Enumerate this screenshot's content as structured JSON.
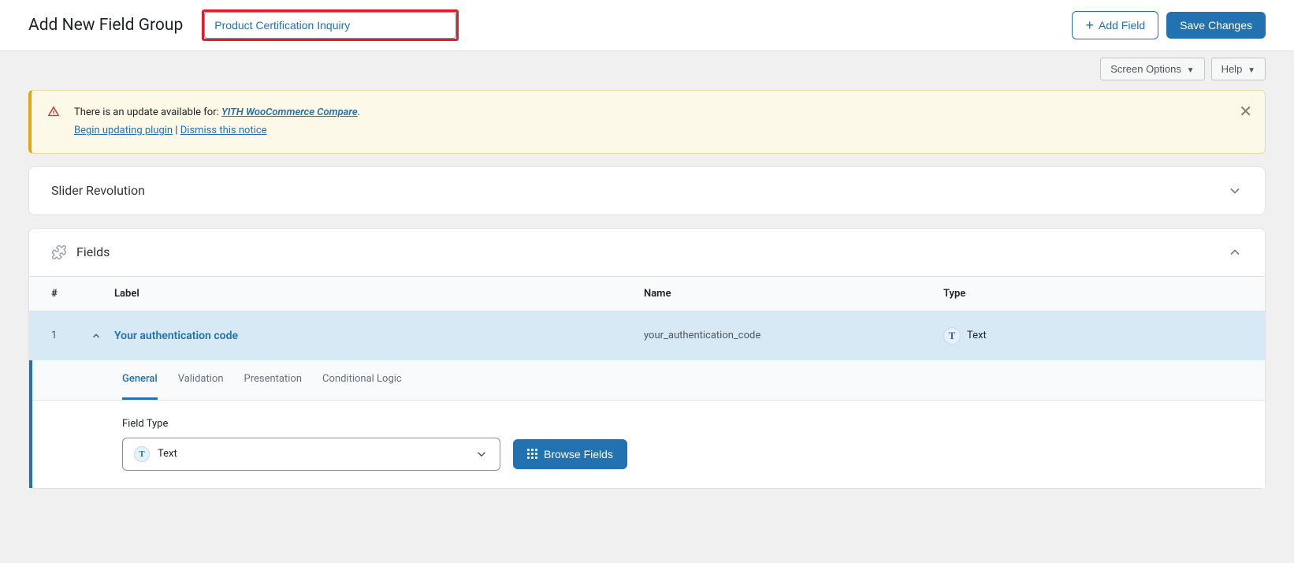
{
  "header": {
    "title": "Add New Field Group",
    "titleInputValue": "Product Certification Inquiry",
    "addFieldLabel": "Add Field",
    "saveLabel": "Save Changes"
  },
  "topControls": {
    "screenOptions": "Screen Options",
    "help": "Help"
  },
  "notice": {
    "line1_prefix": "There is an update available for: ",
    "line1_link": "YITH WooCommerce Compare",
    "line1_suffix": ".",
    "line2_link1": "Begin updating plugin",
    "line2_sep": " | ",
    "line2_link2": "Dismiss this notice"
  },
  "sliderPanel": {
    "title": "Slider Revolution"
  },
  "fieldsPanel": {
    "title": "Fields",
    "columns": {
      "num": "#",
      "label": "Label",
      "name": "Name",
      "type": "Type"
    },
    "row": {
      "num": "1",
      "label": "Your authentication code",
      "name": "your_authentication_code",
      "typeLabel": "Text",
      "typeIconLetter": "T"
    },
    "tabs": {
      "general": "General",
      "validation": "Validation",
      "presentation": "Presentation",
      "conditional": "Conditional Logic"
    },
    "form": {
      "fieldTypeLabel": "Field Type",
      "selectedTypeLabel": "Text",
      "selectedTypeIconLetter": "T",
      "browseFieldsLabel": "Browse Fields"
    }
  }
}
